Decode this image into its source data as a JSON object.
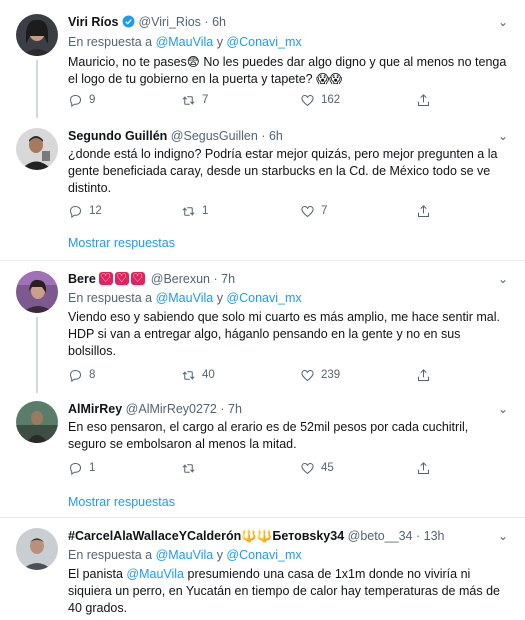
{
  "tweets": [
    {
      "name": "Viri Ríos",
      "handle": "@Viri_Rios",
      "time": "6h",
      "reply_prefix": "En respuesta a",
      "reply_user1": "@MauVila",
      "reply_and": "y",
      "reply_user2": "@Conavi_mx",
      "text": "Mauricio, no te pases😨 No les puedes dar algo digno y que al menos no tenga el logo de tu gobierno en la puerta y tapete? 😱😱",
      "replies": "9",
      "retweets": "7",
      "likes": "162"
    },
    {
      "name": "Segundo Guillén",
      "handle": "@SegusGuillen",
      "time": "6h",
      "text": "¿donde está lo indigno? Podría estar mejor quizás, pero mejor pregunten a la gente beneficiada caray, desde un starbucks en la Cd. de México todo se ve distinto.",
      "replies": "12",
      "retweets": "1",
      "likes": "7"
    },
    {
      "name": "Bere",
      "handle": "@Berexun",
      "time": "7h",
      "reply_prefix": "En respuesta a",
      "reply_user1": "@MauVila",
      "reply_and": "y",
      "reply_user2": "@Conavi_mx",
      "text": "Viendo eso y sabiendo que solo mi cuarto es más amplio, me hace sentir mal. HDP si van a entregar algo, háganlo pensando en la gente y no en sus bolsillos.",
      "replies": "8",
      "retweets": "40",
      "likes": "239"
    },
    {
      "name": "AlMirRey",
      "handle": "@AlMirRey0272",
      "time": "7h",
      "text": "En eso pensaron, el cargo al erario es de 52mil pesos por cada cuchitril, seguro se embolsaron al menos la mitad.",
      "replies": "1",
      "retweets": "",
      "likes": "45"
    },
    {
      "name": "#CarcelAlaWallaceYCalderón🔱🔱Бетовsky34",
      "handle": "@beto__34",
      "time": "13h",
      "reply_prefix": "En respuesta a",
      "reply_user1": "@MauVila",
      "reply_and": "y",
      "reply_user2": "@Conavi_mx",
      "text_prefix": "El panista",
      "text_mention": "@MauVila",
      "text_rest": "presumiendo una casa de 1x1m donde no viviría ni siquiera un perro, en Yucatán en tiempo de calor hay temperaturas de más de 40 grados."
    }
  ],
  "show_replies_label": "Mostrar respuestas",
  "dot": "·",
  "colors": {
    "accent": "#1d9bf0",
    "muted": "#536471",
    "divider": "#e6ecf0"
  }
}
